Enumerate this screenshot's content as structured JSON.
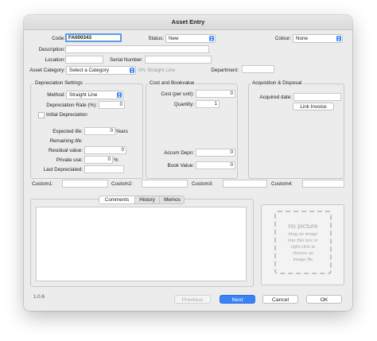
{
  "window": {
    "title": "Asset Entry"
  },
  "header": {
    "code_label": "Code:",
    "code_value": "FA000343",
    "status_label": "Status:",
    "status_value": "New",
    "colour_label": "Colour:",
    "colour_value": "None",
    "description_label": "Description:",
    "description_value": "",
    "location_label": "Location:",
    "location_value": "",
    "serial_label": "Serial Number:",
    "serial_value": "",
    "category_label": "Asset Category:",
    "category_value": "Select a Category",
    "category_hint": "0% Straight Line",
    "department_label": "Department:",
    "department_value": ""
  },
  "depreciation": {
    "title": "Depreciation Settings",
    "method_label": "Method:",
    "method_value": "Straight Line",
    "rate_label": "Depreciation Rate (%):",
    "rate_value": "0",
    "initial_label": "Initial Depreciation",
    "expected_label": "Expected life:",
    "expected_value": "0",
    "expected_unit": "Years",
    "remaining_label": "Remaining life:",
    "residual_label": "Residual value:",
    "residual_value": "0",
    "private_label": "Private use:",
    "private_value": "0",
    "private_unit": "%",
    "last_label": "Last Depreciated:",
    "last_value": ""
  },
  "cost": {
    "title": "Cost and Bookvalue",
    "cost_label": "Cost (per unit):",
    "cost_value": "0",
    "quantity_label": "Quantity:",
    "quantity_value": "1",
    "accum_label": "Accum Depn:",
    "accum_value": "0",
    "book_label": "Book Value:",
    "book_value": "0"
  },
  "acquisition": {
    "title": "Acquisition & Disposal",
    "acquired_label": "Acquired date:",
    "acquired_value": "",
    "link_invoice_label": "Link Invoice"
  },
  "custom": {
    "c1_label": "Custom1:",
    "c2_label": "Custom2:",
    "c3_label": "Custom3:",
    "c4_label": "Custom4:"
  },
  "tabs": [
    {
      "label": "Comments"
    },
    {
      "label": "History"
    },
    {
      "label": "Memos"
    }
  ],
  "picture": {
    "title": "no picture",
    "hint_lines": [
      "drag an image",
      "into this box or",
      "right-click to",
      "choose an",
      "image file"
    ]
  },
  "footer": {
    "version": "1.0.6",
    "previous_label": "Previous",
    "next_label": "Next",
    "cancel_label": "Cancel",
    "ok_label": "OK"
  },
  "colors": {
    "accent": "#3a82f7",
    "focus_ring": "#5a9cf0"
  },
  "icons": {
    "popup_arrow": "chevron-updown-icon"
  }
}
